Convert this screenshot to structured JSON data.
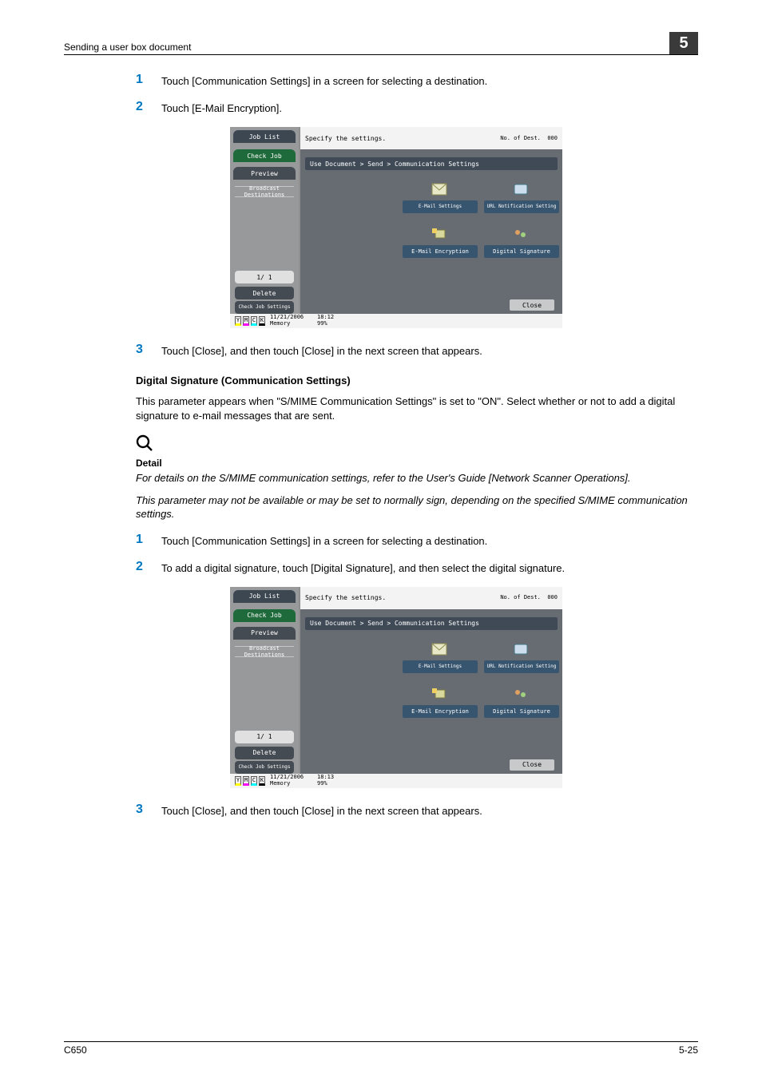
{
  "header": {
    "section_title": "Sending a user box document",
    "chapter_no": "5"
  },
  "steps_a": {
    "s1": {
      "num": "1",
      "text": "Touch [Communication Settings] in a screen for selecting a destination."
    },
    "s2": {
      "num": "2",
      "text": "Touch [E-Mail Encryption]."
    },
    "s3": {
      "num": "3",
      "text": "Touch [Close], and then touch [Close] in the next screen that appears."
    }
  },
  "section2": {
    "title": "Digital Signature (Communication Settings)",
    "intro": "This parameter appears when \"S/MIME Communication Settings\" is set to \"ON\". Select whether or not to add a digital signature to e-mail messages that are sent."
  },
  "detail": {
    "label": "Detail",
    "p1": "For details on the S/MIME communication settings, refer to the User's Guide [Network Scanner Operations].",
    "p2": "This parameter may not be available or may be set to normally sign, depending on the specified S/MIME communication settings."
  },
  "steps_b": {
    "s1": {
      "num": "1",
      "text": "Touch [Communication Settings] in a screen for selecting a destination."
    },
    "s2": {
      "num": "2",
      "text": "To add a digital signature, touch [Digital Signature], and then select the digital signature."
    },
    "s3": {
      "num": "3",
      "text": "Touch [Close], and then touch [Close] in the next screen that appears."
    }
  },
  "screenshot": {
    "specify": "Specify the settings.",
    "noof_label": "No. of\nDest.",
    "noof_val": "000",
    "tab_joblist": "Job List",
    "tab_checkjob": "Check Job",
    "tab_preview": "Preview",
    "broadcast": "Broadcast\nDestinations",
    "pager": "1/  1",
    "delete": "Delete",
    "checkjobset": "Check Job\nSettings",
    "breadcrumb": "Use Document > Send > Communication Settings",
    "btn_email": "E-Mail\nSettings",
    "btn_url": "URL Notification\nSetting",
    "btn_enc": "E-Mail Encryption",
    "btn_sig": "Digital Signature",
    "close": "Close",
    "date1": "11/21/2006",
    "time1": "18:12",
    "date2": "11/21/2006",
    "time2": "18:13",
    "mem_label": "Memory",
    "mem_val": "99%",
    "toners": [
      "Y",
      "M",
      "C",
      "K"
    ]
  },
  "footer": {
    "doc": "C650",
    "page": "5-25"
  }
}
